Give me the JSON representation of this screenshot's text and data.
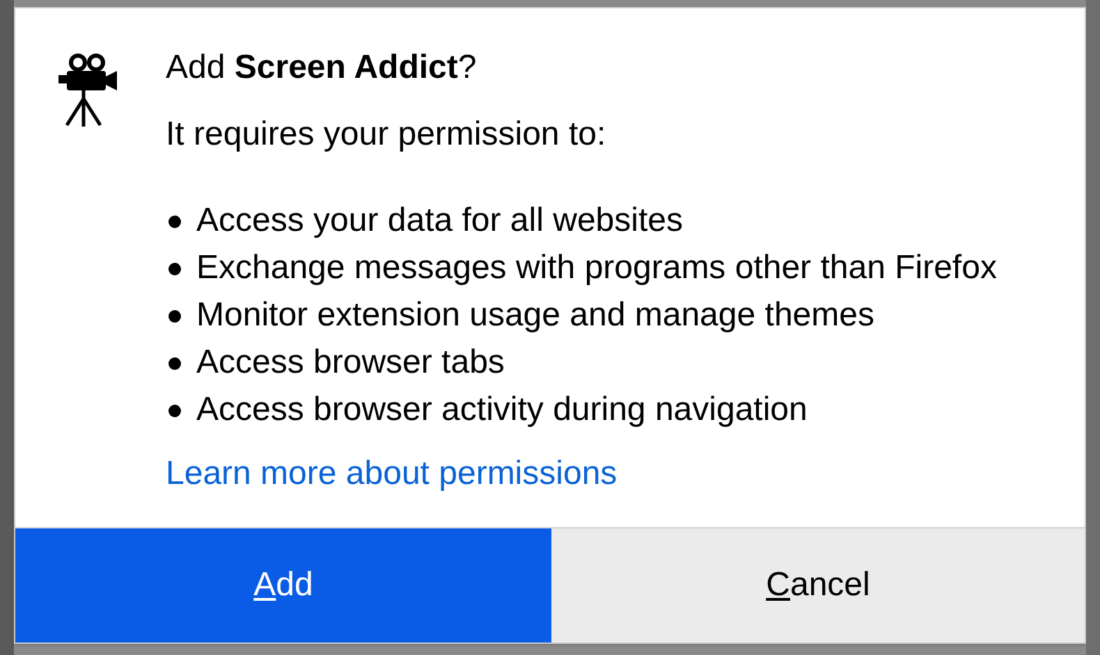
{
  "dialog": {
    "title": "Add **Screen Addict**?",
    "subtitle": "It requires your permission to:",
    "permissions": [
      "Access your data for all websites",
      "Exchange messages with programs other than Firefox",
      "Monitor extension usage and manage themes",
      "Access browser tabs",
      "Access browser activity during navigation"
    ],
    "link": "Learn more about permissions",
    "buttons": [
      {
        "label": "Add",
        "primary": true,
        "access_key_underlined": true
      },
      {
        "label": "Cancel",
        "primary": false,
        "access_key_underlined": true
      }
    ]
  }
}
